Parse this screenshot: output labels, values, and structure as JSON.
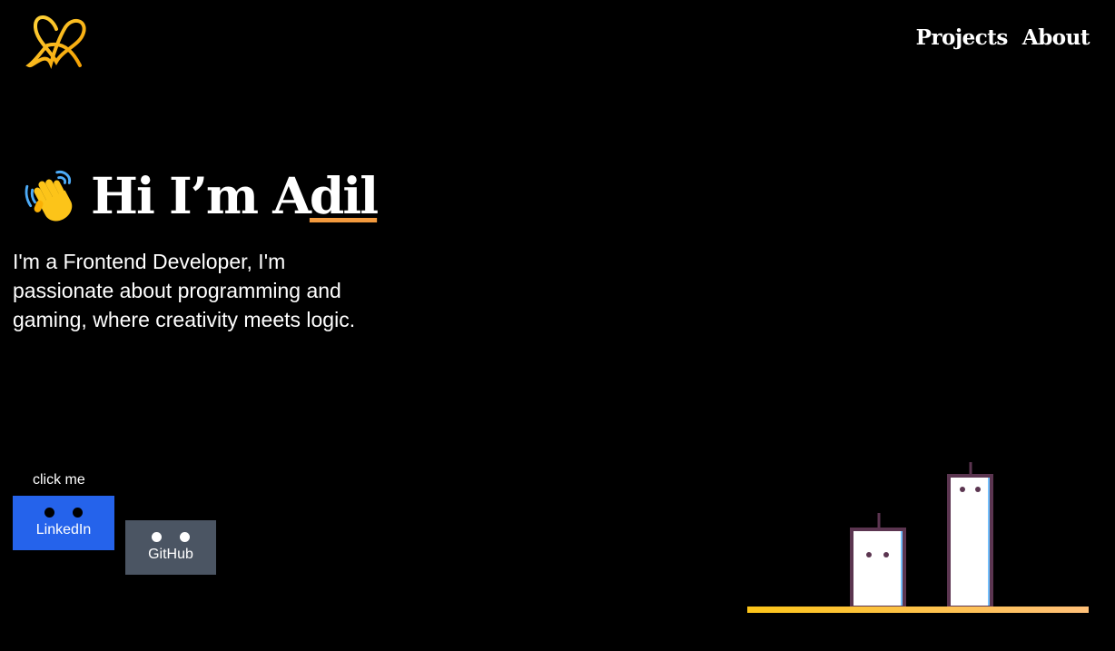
{
  "header": {
    "logo_icon": "heart-a-logo-icon",
    "nav": [
      {
        "label": "Projects"
      },
      {
        "label": "About"
      }
    ]
  },
  "hero": {
    "wave_icon": "waving-hand-icon",
    "title_prefix": "Hi I’m A",
    "title_underlined": "dil",
    "bio": "I'm a Frontend Developer, I'm passionate about programming and gaming, where creativity meets logic."
  },
  "buttons": {
    "hint": "click me",
    "linkedin": "LinkedIn",
    "github": "GitHub"
  },
  "colors": {
    "background": "#000000",
    "accent_orange": "#f39a3e",
    "linkedin_blue": "#2563eb",
    "github_gray": "#4b5563",
    "ground_yellow": "#fcc419",
    "robot_outline": "#5b3550"
  }
}
